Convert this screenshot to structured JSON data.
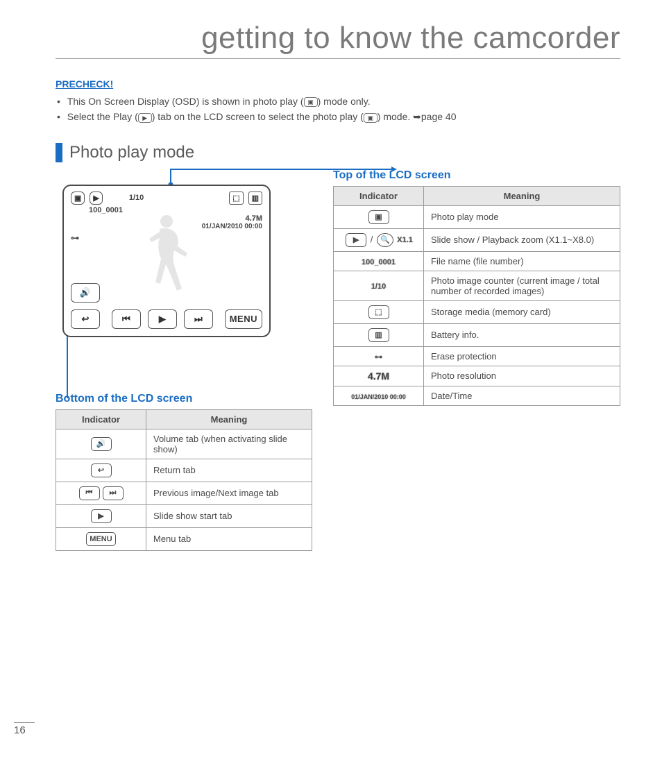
{
  "page": {
    "title": "getting to know the camcorder",
    "number": "16"
  },
  "precheck": {
    "label": "PRECHECK!",
    "items": [
      "This On Screen Display (OSD) is shown in photo play (    ) mode only.",
      "Select the Play (    ) tab on the LCD screen to select the photo play (    ) mode. ➥page 40"
    ]
  },
  "section": {
    "title": "Photo play mode"
  },
  "lcd": {
    "counter": "1/10",
    "file": "100_0001",
    "resolution": "4.7M",
    "datetime": "01/JAN/2010 00:00",
    "menu": "MENU"
  },
  "top_table": {
    "title": "Top of the LCD screen",
    "headers": [
      "Indicator",
      "Meaning"
    ],
    "rows": [
      {
        "icon": "photo-play",
        "meaning": "Photo play mode"
      },
      {
        "icon": "slide-zoom",
        "label": "X1.1",
        "meaning": "Slide show / Playback zoom (X1.1~X8.0)"
      },
      {
        "icon": "text",
        "label": "100_0001",
        "meaning": "File name (file number)"
      },
      {
        "icon": "text",
        "label": "1/10",
        "meaning": "Photo image counter (current image / total number of recorded images)"
      },
      {
        "icon": "card",
        "meaning": "Storage media (memory card)"
      },
      {
        "icon": "battery",
        "meaning": "Battery info."
      },
      {
        "icon": "key",
        "meaning": "Erase protection"
      },
      {
        "icon": "text-outline",
        "label": "4.7M",
        "meaning": "Photo resolution"
      },
      {
        "icon": "text",
        "label": "01/JAN/2010 00:00",
        "meaning": "Date/Time"
      }
    ]
  },
  "bottom_table": {
    "title": "Bottom of the LCD screen",
    "headers": [
      "Indicator",
      "Meaning"
    ],
    "rows": [
      {
        "icon": "volume",
        "meaning": "Volume tab (when activating slide show)"
      },
      {
        "icon": "return",
        "meaning": "Return tab"
      },
      {
        "icon": "prev-next",
        "meaning": "Previous image/Next image tab"
      },
      {
        "icon": "slideshow",
        "meaning": "Slide show start tab"
      },
      {
        "icon": "menu",
        "label": "MENU",
        "meaning": "Menu tab"
      }
    ]
  }
}
